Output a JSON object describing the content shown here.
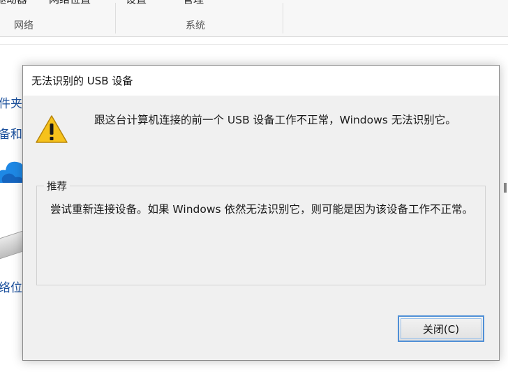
{
  "background_window": {
    "ribbon_cut_labels": [
      "驱动器",
      "网络位置",
      "设置",
      "管理"
    ],
    "group_labels": [
      "网络",
      "系统"
    ],
    "nav_fragments": [
      "件夹",
      "备和",
      "络位"
    ]
  },
  "dialog": {
    "title": "无法识别的 USB 设备",
    "message": "跟这台计算机连接的前一个 USB 设备工作不正常，Windows 无法识别它。",
    "group_title": "推荐",
    "recommendation": "尝试重新连接设备。如果 Windows 依然无法识别它，则可能是因为该设备工作不正常。",
    "close_label": "关闭(C)",
    "icon": "warning-icon"
  },
  "colors": {
    "accent": "#4f8fd6",
    "warning_yellow": "#f6c21c",
    "link_blue": "#1a4f9c"
  }
}
